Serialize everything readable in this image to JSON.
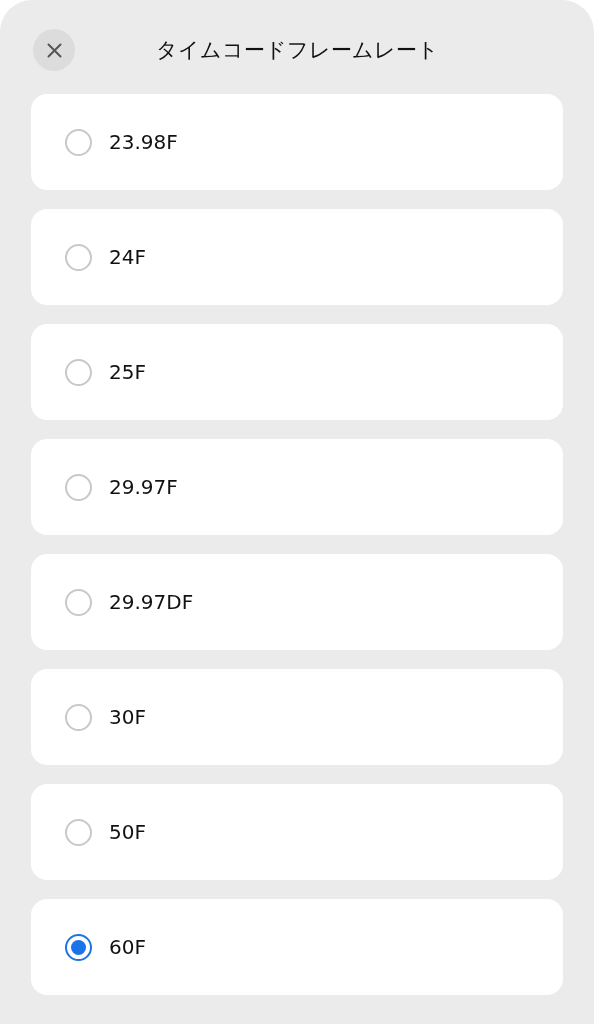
{
  "header": {
    "title": "タイムコードフレームレート"
  },
  "options": [
    {
      "label": "23.98F",
      "selected": false
    },
    {
      "label": "24F",
      "selected": false
    },
    {
      "label": "25F",
      "selected": false
    },
    {
      "label": "29.97F",
      "selected": false
    },
    {
      "label": "29.97DF",
      "selected": false
    },
    {
      "label": "30F",
      "selected": false
    },
    {
      "label": "50F",
      "selected": false
    },
    {
      "label": "60F",
      "selected": true
    }
  ]
}
